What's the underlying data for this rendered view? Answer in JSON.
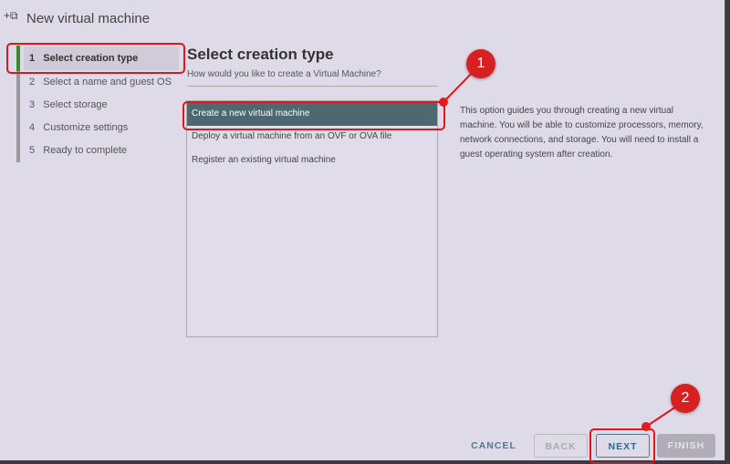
{
  "dialog": {
    "title": "New virtual machine",
    "icon": "new-vm-icon"
  },
  "steps": [
    {
      "num": "1",
      "label": "Select creation type"
    },
    {
      "num": "2",
      "label": "Select a name and guest OS"
    },
    {
      "num": "3",
      "label": "Select storage"
    },
    {
      "num": "4",
      "label": "Customize settings"
    },
    {
      "num": "5",
      "label": "Ready to complete"
    }
  ],
  "main": {
    "heading": "Select creation type",
    "subheading": "How would you like to create a Virtual Machine?",
    "options": [
      "Create a new virtual machine",
      "Deploy a virtual machine from an OVF or OVA file",
      "Register an existing virtual machine"
    ],
    "description": "This option guides you through creating a new virtual machine. You will be able to customize processors, memory, network connections, and storage. You will need to install a guest operating system after creation."
  },
  "buttons": {
    "cancel": "CANCEL",
    "back": "BACK",
    "next": "NEXT",
    "finish": "FINISH"
  },
  "annotations": [
    "1",
    "2"
  ],
  "colors": {
    "accent": "#3c8a2e",
    "selected": "#4c6870",
    "annotation": "#e3151b"
  }
}
